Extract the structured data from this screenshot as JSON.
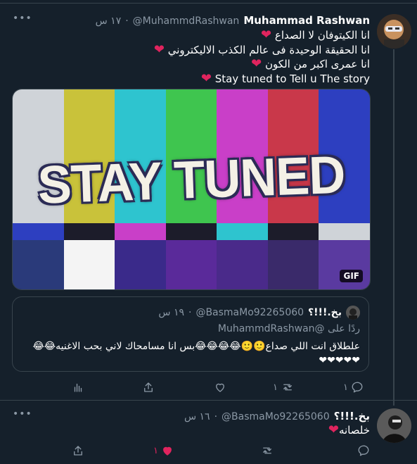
{
  "tweet": {
    "name": "Muhammad Rashwan",
    "handle": "@MuhammdRashwan",
    "dot": "·",
    "time": "١٧ س",
    "lines": [
      "انا الكيتوفان لا الصداع",
      "انا الحقيقة الوحيدة فى عالم الكذب الاليكتروني",
      "انا عمرى اكبر من الكون",
      "Stay tuned to Tell u The story"
    ],
    "media": {
      "text": "STAY TUNED",
      "badge": "GIF"
    },
    "quote": {
      "name": "بخ.!!!؟",
      "handle": "@BasmaMo92265060",
      "dot": "·",
      "time": "١٩ س",
      "reply_prefix": "ردًا على",
      "reply_to": "@MuhammdRashwan",
      "text": "علطلاق انت اللي صداع🙂🙂😂😂😂😂بس انا مسامحاك لاني بحب الاغنيه😂😂❤❤❤❤❤"
    },
    "counts": {
      "reply": "١",
      "retweet": "١"
    }
  },
  "reply_tweet": {
    "name": "بخ.!!!؟",
    "handle": "@BasmaMo92265060",
    "dot": "·",
    "time": "١٦ س",
    "text": "خلصانه",
    "counts": {
      "like": "١"
    }
  },
  "colors": {
    "background": "#15202b",
    "secondary_text": "#8b98a5",
    "like": "#e0245e",
    "border": "#38444d"
  },
  "icons": {
    "more": "more-icon",
    "reply": "reply-icon",
    "retweet": "retweet-icon",
    "like": "heart-icon",
    "share": "share-icon",
    "analytics": "analytics-icon"
  }
}
